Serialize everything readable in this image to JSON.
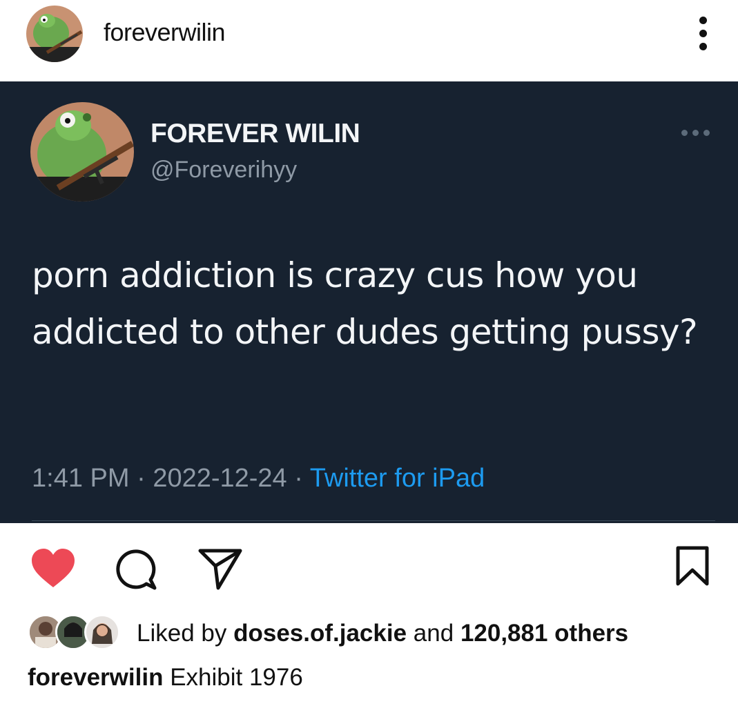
{
  "post": {
    "username": "foreverwilin",
    "avatar_icon": "frog-with-rifle-avatar",
    "more_icon": "vertical-dots-icon"
  },
  "tweet": {
    "display_name": "FOREVER WILIN",
    "handle": "@Foreverihyy",
    "text": "porn addiction is crazy cus how you addicted to other dudes getting pussy?",
    "time": "1:41 PM",
    "separator": "·",
    "date": "2022-12-24",
    "source": "Twitter for iPad",
    "more_icon": "horizontal-dots-icon",
    "colors": {
      "background": "#172230",
      "text": "#f3f5f7",
      "muted": "#8f9aa6",
      "link": "#1d9bf0"
    }
  },
  "actions": {
    "like_icon": "heart-filled-icon",
    "comment_icon": "comment-icon",
    "share_icon": "paper-plane-icon",
    "save_icon": "bookmark-icon",
    "like_color": "#ed4956"
  },
  "likes": {
    "prefix": "Liked by",
    "user": "doses.of.jackie",
    "conjunction": "and",
    "others": "120,881 others"
  },
  "caption": {
    "username": "foreverwilin",
    "text": "Exhibit 1976"
  }
}
